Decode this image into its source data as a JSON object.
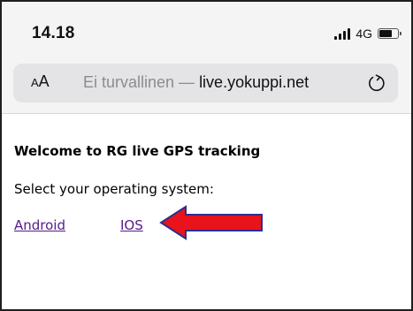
{
  "status_bar": {
    "time": "14.18",
    "network": "4G"
  },
  "browser": {
    "reader_small": "A",
    "reader_big": "A",
    "security_text": "Ei turvallinen — ",
    "domain": "live.yokuppi.net"
  },
  "page": {
    "heading": "Welcome to RG live GPS tracking",
    "prompt": "Select your operating system:",
    "links": {
      "android": "Android",
      "ios": "IOS"
    }
  },
  "colors": {
    "link_visited": "#551a8b",
    "arrow_fill": "#e8131b",
    "arrow_outline": "#2a2f8f"
  }
}
